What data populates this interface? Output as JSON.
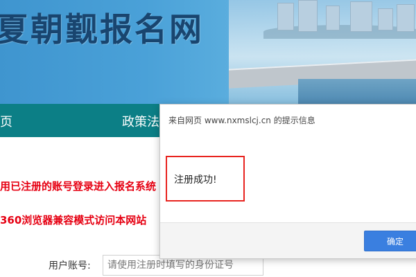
{
  "banner": {
    "title": "夏朝觐报名网"
  },
  "nav": {
    "items": [
      {
        "label": "页"
      },
      {
        "label": "政策法"
      }
    ]
  },
  "content": {
    "notice_1": "用已注册的账号登录进入报名系统",
    "notice_2": "360浏览器兼容模式访问本网站",
    "notice_2_tail": "（",
    "account_label": "用户账号:",
    "account_placeholder": "请使用注册时填写的身份证号"
  },
  "dialog": {
    "title": "来自网页 www.nxmslcj.cn 的提示信息",
    "message": "注册成功!",
    "ok_label": "确定"
  },
  "colors": {
    "nav_bg": "#0c7f86",
    "notice_red": "#e60012",
    "highlight_border": "#e8231f",
    "ok_button": "#3a7fe0"
  }
}
